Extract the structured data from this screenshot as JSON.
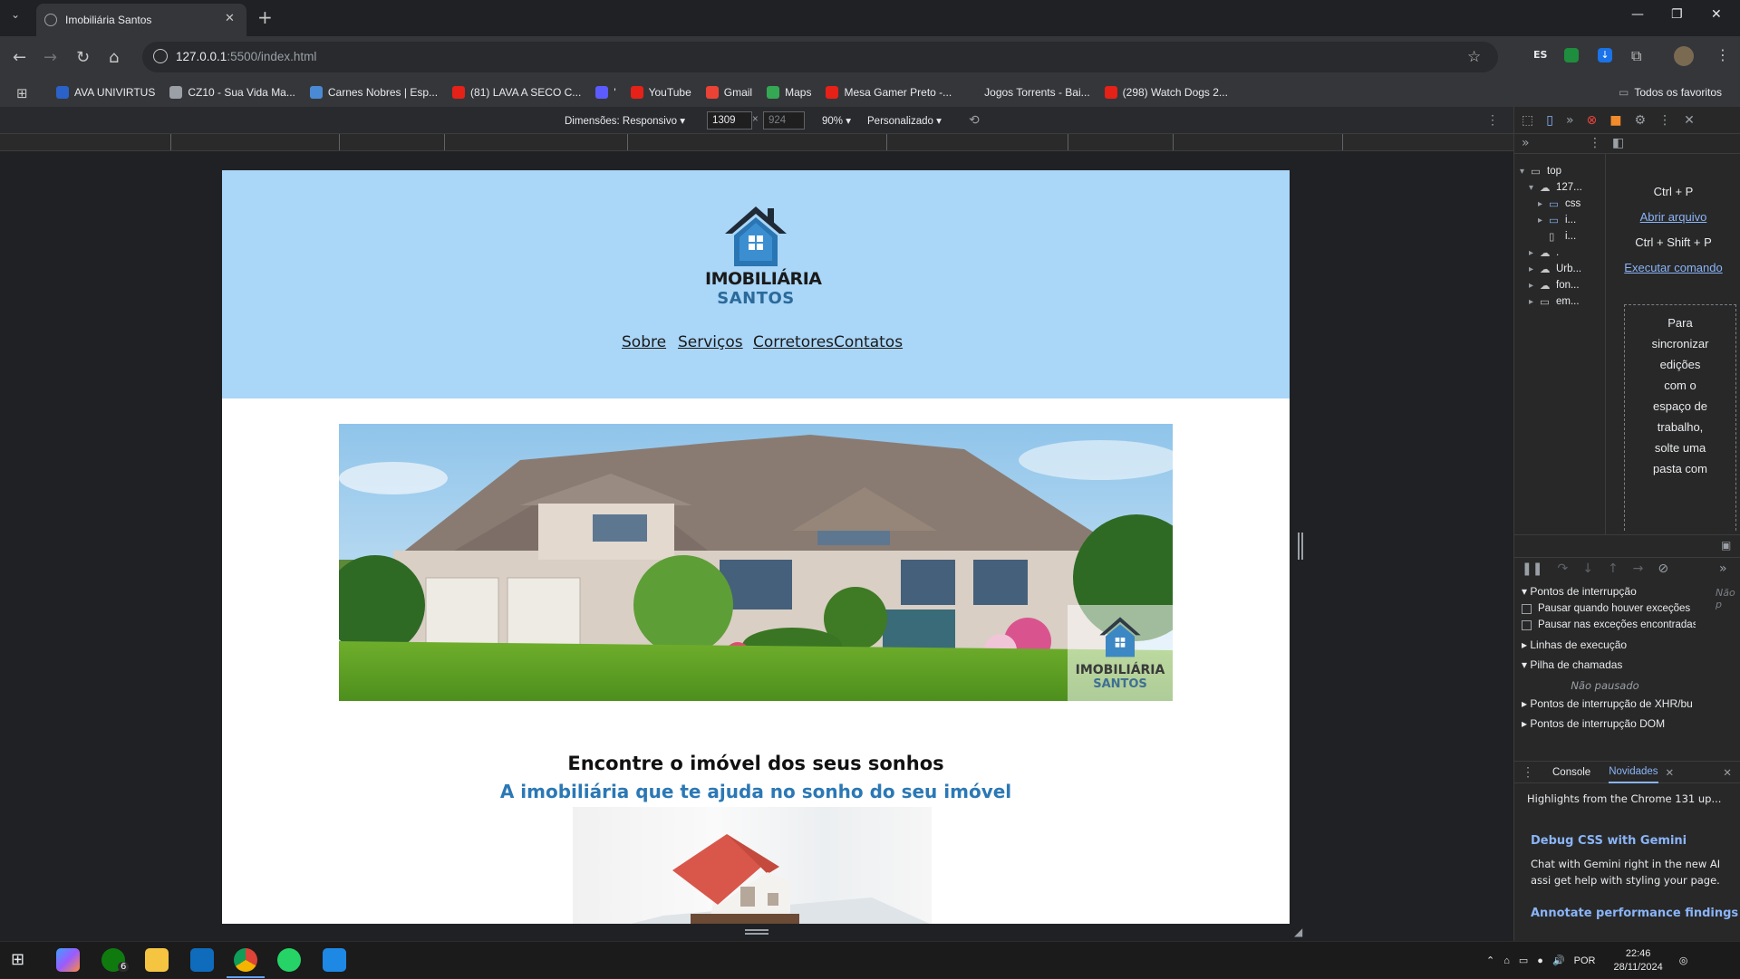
{
  "browser": {
    "tab_title": "Imobiliária Santos",
    "url_host": "127.0.0.1",
    "url_rest": ":5500/index.html",
    "profile_badge": "ES",
    "bookmarks": [
      {
        "label": "AVA UNIVIRTUS",
        "color": "#2a62c9"
      },
      {
        "label": "CZ10 - Sua Vida Ma...",
        "color": "#9aa0a6"
      },
      {
        "label": "Carnes Nobres | Esp...",
        "color": "#4a8ad4"
      },
      {
        "label": "(81) LAVA A SECO C...",
        "color": "#e62117"
      },
      {
        "label": "'",
        "color": "#5b5bff"
      },
      {
        "label": "YouTube",
        "color": "#e62117"
      },
      {
        "label": "Gmail",
        "color": "#ea4335"
      },
      {
        "label": "Maps",
        "color": "#34a853"
      },
      {
        "label": "Mesa Gamer Preto -...",
        "color": "#e62117"
      },
      {
        "label": "Jogos Torrents - Bai...",
        "color": "#35363a"
      },
      {
        "label": "(298) Watch Dogs 2...",
        "color": "#e62117"
      }
    ],
    "all_bookmarks": "Todos os favoritos"
  },
  "device_toolbar": {
    "dimensions": "Dimensões: Responsivo",
    "width": "1309",
    "height": "924",
    "x_sep": "×",
    "zoom": "90%",
    "throttle": "Personalizado"
  },
  "site": {
    "logo_line1": "IMOBILIÁRIA",
    "logo_line2": "SANTOS",
    "nav": [
      "Sobre",
      "Serviços",
      "Corretores",
      "Contatos"
    ],
    "watermark_line1": "IMOBILIÁRIA",
    "watermark_line2": "SANTOS",
    "headline": "Encontre o imóvel dos seus sonhos",
    "subheadline": "A imobiliária que te ajuda no sonho do seu imóvel"
  },
  "devtools": {
    "tree": [
      {
        "label": "top",
        "depth": 0,
        "icon": "frame"
      },
      {
        "label": "127...",
        "depth": 1,
        "icon": "cloud"
      },
      {
        "label": "css",
        "depth": 2,
        "icon": "folder"
      },
      {
        "label": "i...",
        "depth": 2,
        "icon": "folder"
      },
      {
        "label": "i...",
        "depth": 2,
        "icon": "file"
      },
      {
        "label": ".",
        "depth": 1,
        "icon": "cloud"
      },
      {
        "label": "Urb...",
        "depth": 1,
        "icon": "cloud"
      },
      {
        "label": "fon...",
        "depth": 1,
        "icon": "cloud"
      },
      {
        "label": "em...",
        "depth": 1,
        "icon": "frame"
      }
    ],
    "shortcut1": "Ctrl + P",
    "open_file": "Abrir arquivo",
    "shortcut2": "Ctrl + Shift + P",
    "run_command": "Executar comando",
    "sync_hint": [
      "Para",
      "sincronizar",
      "edições",
      "com o",
      "espaço de",
      "trabalho,",
      "solte uma",
      "pasta com"
    ],
    "breakpoints": "Pontos de interrupção",
    "pause_caught": "Pausar quando houver exceções",
    "pause_uncaught": "Pausar nas exceções encontradas",
    "threads": "Linhas de execução",
    "call_stack": "Pilha de chamadas",
    "not_paused": "Não pausado",
    "xhr_breakpoints": "Pontos de interrupção de XHR/bu",
    "dom_breakpoints": "Pontos de interrupção DOM",
    "side_not": "Não p",
    "drawer_tabs": [
      "Console",
      "Novidades"
    ],
    "highlights": "Highlights from the Chrome 131 up...",
    "item1_title": "Debug CSS with Gemini",
    "item1_text": "Chat with Gemini right in the new AI assi get help with styling your page.",
    "item2_title": "Annotate performance findings"
  },
  "taskbar": {
    "lang": "POR",
    "time": "22:46",
    "date": "28/11/2024",
    "badge": "6"
  }
}
